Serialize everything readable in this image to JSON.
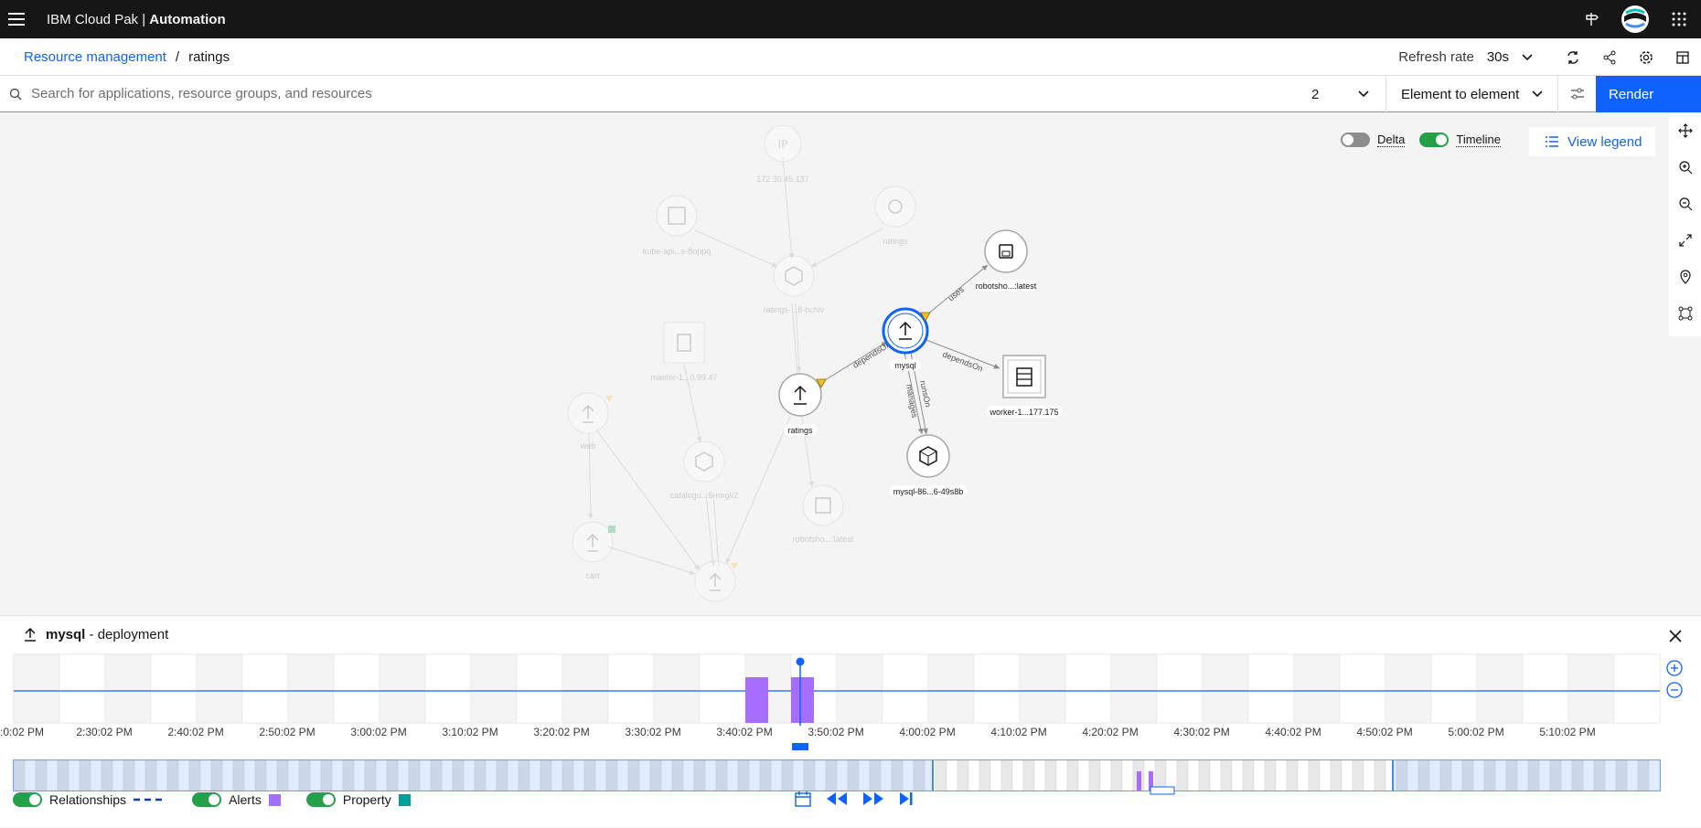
{
  "header": {
    "brand_prefix": "IBM Cloud Pak |",
    "brand_product": "Automation"
  },
  "breadcrumb": {
    "root": "Resource management",
    "separator": "/",
    "current": "ratings"
  },
  "refresh": {
    "label": "Refresh rate",
    "value": "30s"
  },
  "search": {
    "placeholder": "Search for applications, resource groups, and resources",
    "hops": "2",
    "hop_type": "Element to element",
    "render_label": "Render"
  },
  "view": {
    "delta_label": "Delta",
    "delta_on": false,
    "timeline_label": "Timeline",
    "timeline_on": true,
    "legend_label": "View legend"
  },
  "graph": {
    "faded_nodes": [
      {
        "label": "172.30.45.137"
      },
      {
        "label": "kube-api...s-8nppq"
      },
      {
        "label": "ratings"
      },
      {
        "label": "ratings-...8-bchlv"
      },
      {
        "label": "master-1...0.99.47"
      },
      {
        "label": "web"
      },
      {
        "label": "catalogu...6-mrgk2"
      },
      {
        "label": "robotsho...:latest"
      },
      {
        "label": "cart"
      }
    ],
    "active_nodes": [
      {
        "label": "ratings"
      },
      {
        "label": "mysql"
      },
      {
        "label": "robotsho...:latest"
      },
      {
        "label": "worker-1...177.175"
      },
      {
        "label": "mysql-86...6-49s8b"
      }
    ],
    "edges": [
      {
        "label": "dependsOn"
      },
      {
        "label": "uses"
      },
      {
        "label": "dependsOn"
      },
      {
        "label": "runsOn"
      },
      {
        "label": "manages"
      }
    ]
  },
  "detail": {
    "name": "mysql",
    "type": "- deployment"
  },
  "timeline": {
    "ticks": [
      ":0:02 PM",
      "2:30:02 PM",
      "2:40:02 PM",
      "2:50:02 PM",
      "3:00:02 PM",
      "3:10:02 PM",
      "3:20:02 PM",
      "3:30:02 PM",
      "3:40:02 PM",
      "3:50:02 PM",
      "4:00:02 PM",
      "4:10:02 PM",
      "4:20:02 PM",
      "4:30:02 PM",
      "4:40:02 PM",
      "4:50:02 PM",
      "5:00:02 PM",
      "5:10:02 PM"
    ]
  },
  "legend": {
    "relationships": "Relationships",
    "alerts": "Alerts",
    "property": "Property",
    "alert_color": "#a56eff",
    "property_color": "#009d9a"
  }
}
